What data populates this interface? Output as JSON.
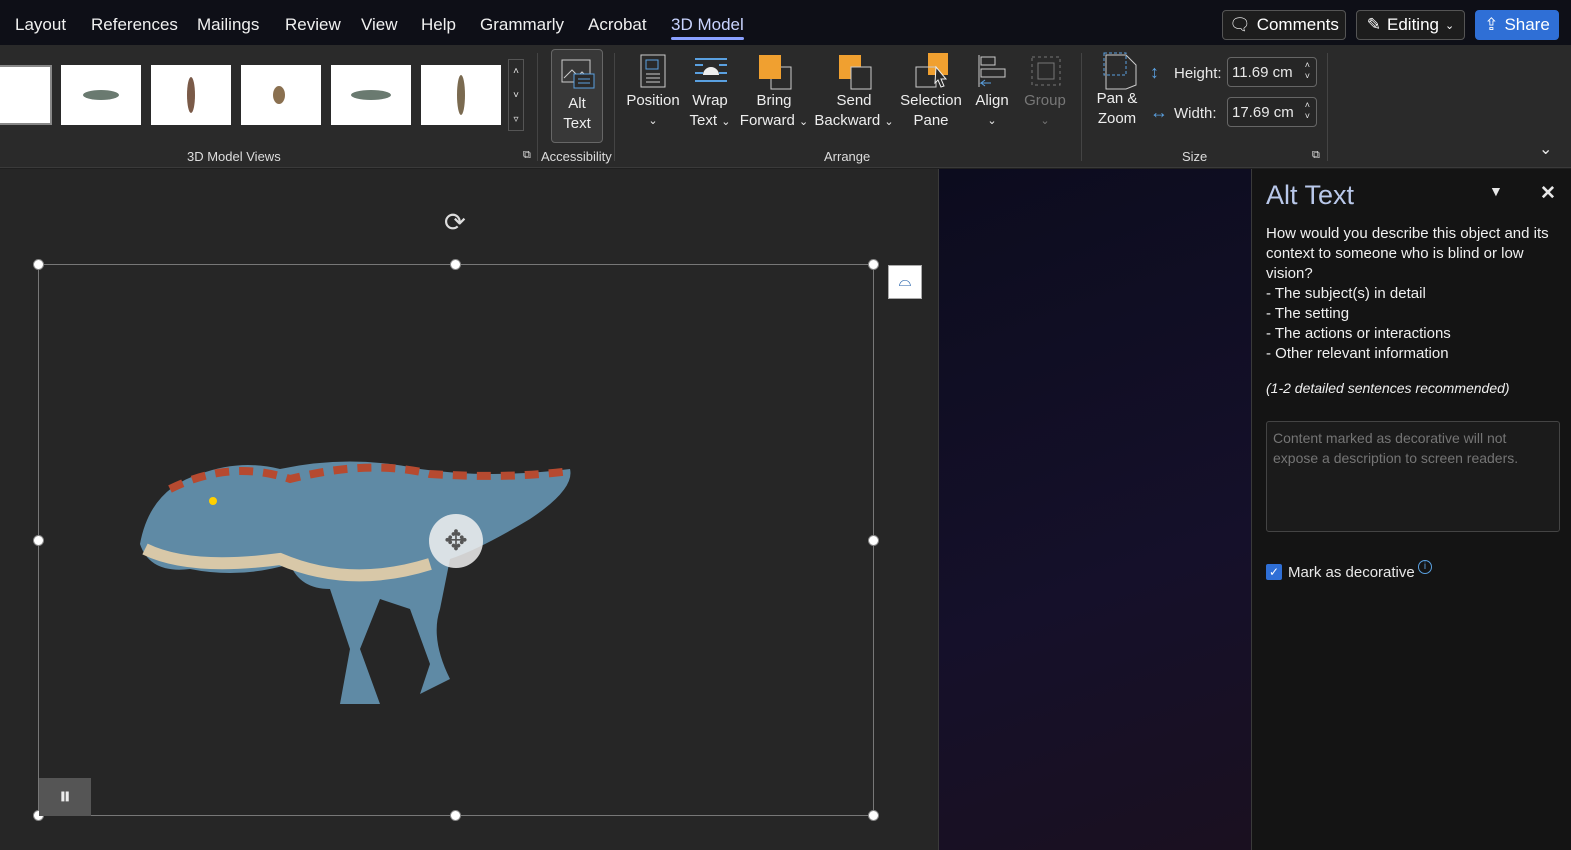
{
  "menu": {
    "tabs": [
      "Layout",
      "References",
      "Mailings",
      "Review",
      "View",
      "Help",
      "Grammarly",
      "Acrobat",
      "3D Model"
    ],
    "comments": "Comments",
    "editing": "Editing",
    "share": "Share"
  },
  "ribbon": {
    "views_group": "3D Model Views",
    "accessibility_group": "Accessibility",
    "alt_text": [
      "Alt",
      "Text"
    ],
    "position": "Position",
    "wrap": [
      "Wrap",
      "Text"
    ],
    "bring": [
      "Bring",
      "Forward"
    ],
    "send": [
      "Send",
      "Backward"
    ],
    "selection": [
      "Selection",
      "Pane"
    ],
    "align": "Align",
    "group": "Group",
    "arrange_group": "Arrange",
    "pan": [
      "Pan &",
      "Zoom"
    ],
    "height_label": "Height:",
    "height_value": "11.69 cm",
    "width_label": "Width:",
    "width_value": "17.69 cm",
    "size_group": "Size"
  },
  "pane": {
    "title": "Alt Text",
    "question": "How would you describe this object and its context to someone who is blind or low vision?",
    "bullets": [
      "- The subject(s) in detail",
      "- The setting",
      "- The actions or interactions",
      "- Other relevant information"
    ],
    "hint": "(1-2 detailed sentences recommended)",
    "placeholder": "Content marked as decorative will not expose a description to screen readers.",
    "decorative_label": "Mark as decorative",
    "decorative_checked": true
  },
  "colors": {
    "accent": "#3f7fe0",
    "orange": "#f0a030"
  }
}
